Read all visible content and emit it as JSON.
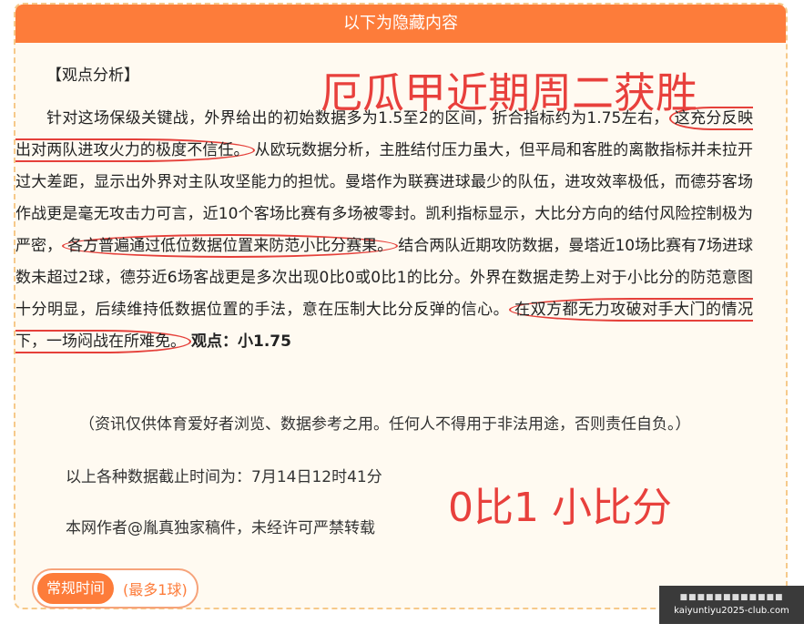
{
  "header": {
    "title": "以下为隐藏内容"
  },
  "overlay": {
    "title": "厄瓜甲近期周二获胜",
    "score": "0比1 小比分"
  },
  "article": {
    "section_label": "【观点分析】",
    "p1": "针对这场保级关键战，外界给出的初始数据多为1.5至2的区间，折合指标约为1.75左右，",
    "c1": "这充分反映出对两队进攻火力的极度不信任。",
    "p2": "从欧玩数据分析，主胜结付压力虽大，但平局和客胜的离散指标并未拉开过大差距，显示出外界对主队攻坚能力的担忧。曼塔作为联赛进球最少的队伍，进攻效率极低，而德芬客场作战更是毫无攻击力可言，近10个客场比赛有多场被零封。凯利指标显示，大比分方向的结付风险控制极为严密，",
    "c2": "各方普遍通过低位数据位置来防范小比分赛果。",
    "p3": "结合两队近期攻防数据，曼塔近10场比赛有7场进球数未超过2球，德芬近6场客战更是多次出现0比0或0比1的比分。外界在数据走势上对于小比分的防范意图十分明显，后续维持低数据位置的手法，意在压制大比分反弹的信心。",
    "c3": "在双方都无力攻破对手大门的情况下，一场闷战在所难免。",
    "view_label": "观点：小1.75"
  },
  "disclaimer": "（资讯仅供体育爱好者浏览、数据参考之用。任何人不得用于非法用途，否则责任自负。）",
  "cutoff": "以上各种数据截止时间为：7月14日12时41分",
  "copyright": "本网作者@胤真独家稿件，未经许可严禁转载",
  "tag": {
    "main": "常规时间",
    "sub": "(最多1球)"
  },
  "watermark": {
    "line1": "■■■■■■■■■■■■",
    "line2": "kaiyuntiyu2025-club.com"
  }
}
